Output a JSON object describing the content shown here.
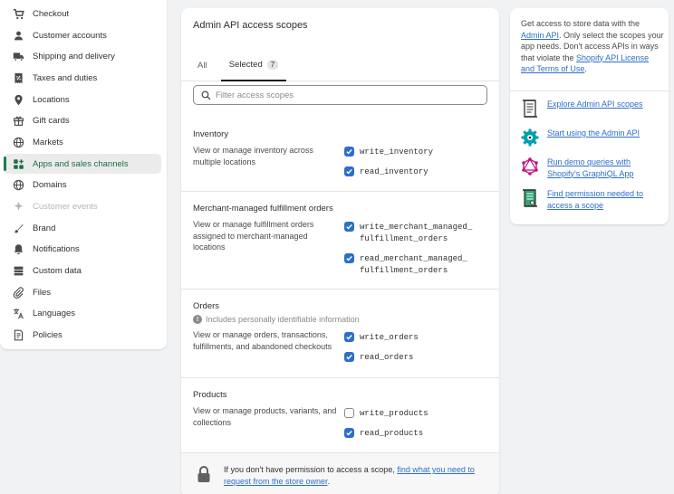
{
  "sidebar": {
    "items": [
      {
        "label": "Checkout",
        "icon": "cart-icon"
      },
      {
        "label": "Customer accounts",
        "icon": "person-icon"
      },
      {
        "label": "Shipping and delivery",
        "icon": "truck-icon"
      },
      {
        "label": "Taxes and duties",
        "icon": "receipt-icon"
      },
      {
        "label": "Locations",
        "icon": "location-pin-icon"
      },
      {
        "label": "Gift cards",
        "icon": "gift-icon"
      },
      {
        "label": "Markets",
        "icon": "globe-icon"
      },
      {
        "label": "Apps and sales channels",
        "icon": "apps-icon",
        "active": true
      },
      {
        "label": "Domains",
        "icon": "globe-icon"
      },
      {
        "label": "Customer events",
        "icon": "sparkle-icon",
        "disabled": true
      },
      {
        "label": "Brand",
        "icon": "brand-icon"
      },
      {
        "label": "Notifications",
        "icon": "bell-icon"
      },
      {
        "label": "Custom data",
        "icon": "database-icon"
      },
      {
        "label": "Files",
        "icon": "paperclip-icon"
      },
      {
        "label": "Languages",
        "icon": "translate-icon"
      },
      {
        "label": "Policies",
        "icon": "document-icon"
      }
    ]
  },
  "main": {
    "title": "Admin API access scopes",
    "tabs": {
      "all": "All",
      "selected": "Selected",
      "selected_count": "7"
    },
    "search_placeholder": "Filter access scopes",
    "sections": [
      {
        "title": "Inventory",
        "description": "View or manage inventory across multiple locations",
        "scopes": [
          {
            "name": "write_inventory",
            "checked": true
          },
          {
            "name": "read_inventory",
            "checked": true
          }
        ]
      },
      {
        "title": "Merchant-managed fulfillment orders",
        "description": "View or manage fulfillment orders assigned to merchant-managed locations",
        "scopes": [
          {
            "name": "write_merchant_managed_\nfulfillment_orders",
            "checked": true
          },
          {
            "name": "read_merchant_managed_\nfulfillment_orders",
            "checked": true
          }
        ]
      },
      {
        "title": "Orders",
        "pii_note": "Includes personally identifiable information",
        "description": "View or manage orders, transactions, fulfillments, and abandoned checkouts",
        "scopes": [
          {
            "name": "write_orders",
            "checked": true
          },
          {
            "name": "read_orders",
            "checked": true
          }
        ]
      },
      {
        "title": "Products",
        "description": "View or manage products, variants, and collections",
        "scopes": [
          {
            "name": "write_products",
            "checked": false
          },
          {
            "name": "read_products",
            "checked": true
          }
        ]
      }
    ],
    "footer": {
      "text_before": "If you don't have permission to access a scope, ",
      "link": "find what you need to request from the store owner",
      "text_after": "."
    }
  },
  "right_panel": {
    "intro": {
      "p1": "Get access to store data with the ",
      "link1": "Admin API",
      "p2": ". Only select the scopes your app needs. Don't access APIs in ways that violate the ",
      "link2": "Shopify API License and Terms of Use",
      "p3": "."
    },
    "resources": [
      {
        "label": "Explore Admin API scopes",
        "icon": "scroll-icon"
      },
      {
        "label": "Start using the Admin API",
        "icon": "gear-icon"
      },
      {
        "label": "Run demo queries with Shopify's GraphiQL App",
        "icon": "graphql-icon"
      },
      {
        "label": "Find permission needed to access a scope",
        "icon": "permission-scroll-icon"
      }
    ]
  }
}
